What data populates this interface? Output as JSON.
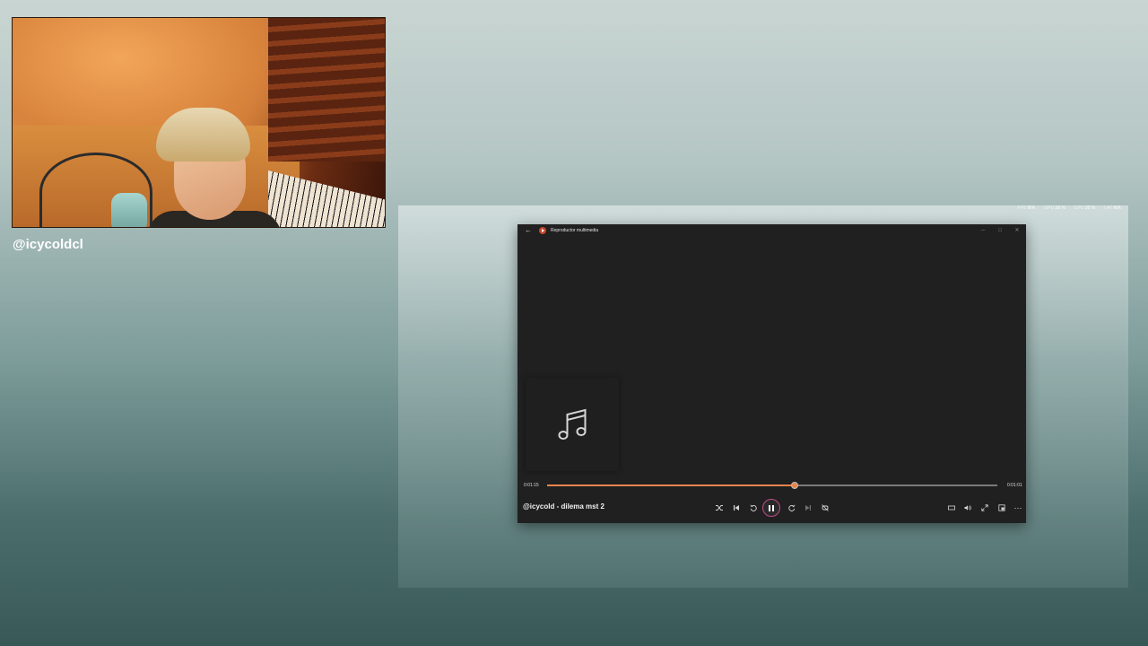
{
  "streamer": {
    "username": "@icycoldcl"
  },
  "overlay_stats": [
    {
      "label": "FPS",
      "value": "N/A"
    },
    {
      "label": "GPU",
      "value": "28 %"
    },
    {
      "label": "CPU",
      "value": "35 %"
    },
    {
      "label": "LAT",
      "value": "N/A"
    }
  ],
  "player": {
    "window_title": "Reproductor multimedia",
    "track_title": "@icycold - dilema mst 2",
    "elapsed": "0:01:15",
    "duration": "0:01:01",
    "progress": 0.55,
    "accent_color": "#e8844c"
  }
}
